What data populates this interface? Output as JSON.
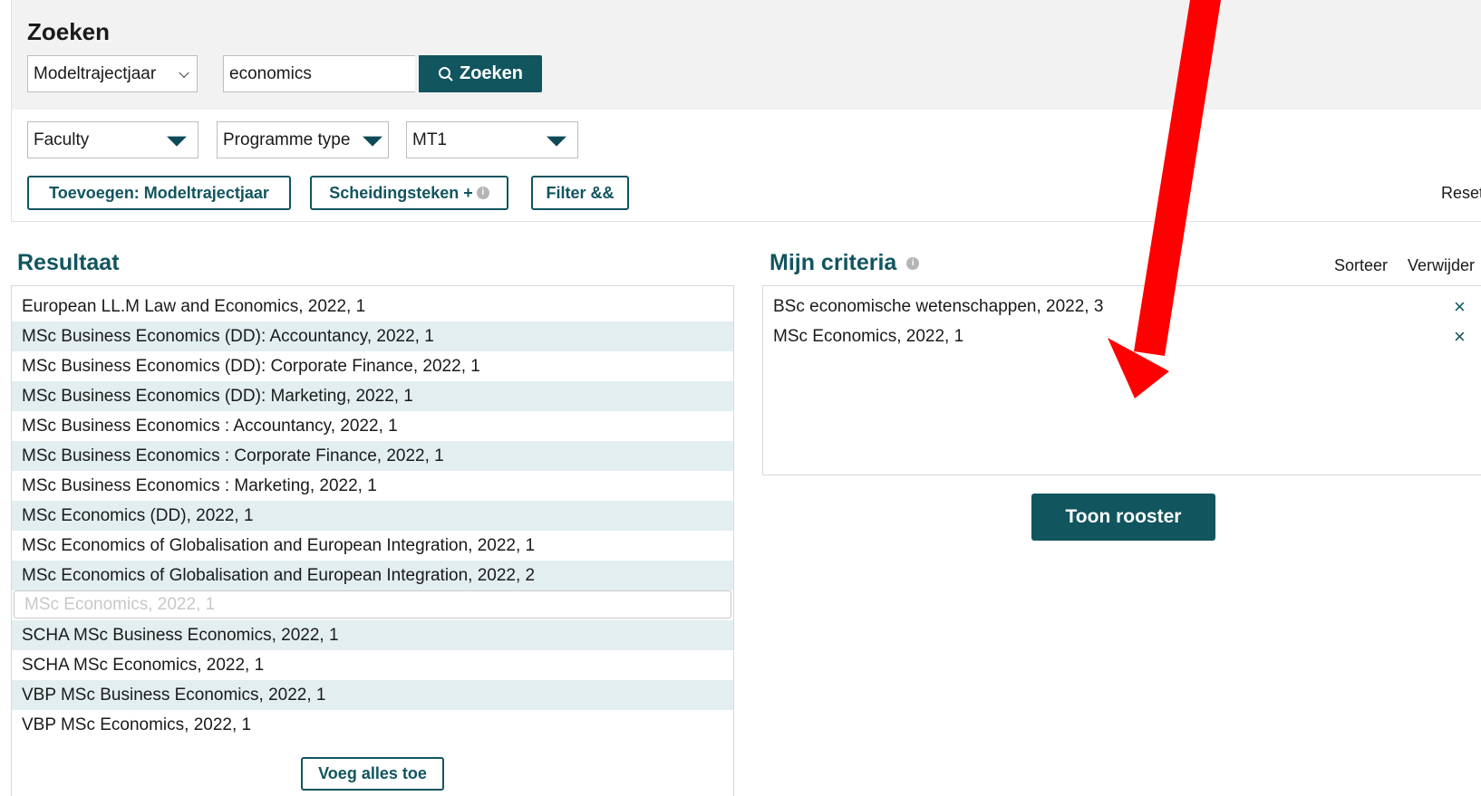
{
  "search": {
    "title": "Zoeken",
    "type_select": "Modeltrajectjaar",
    "query": "economics",
    "search_button": "Zoeken"
  },
  "filters": {
    "faculty": "Faculty",
    "programme_type": "Programme type",
    "mt": "MT1"
  },
  "actions": {
    "add_button": "Toevoegen: Modeltrajectjaar",
    "separator_button": "Scheidingsteken +",
    "filter_button": "Filter &&",
    "reset": "Reset"
  },
  "results": {
    "title": "Resultaat",
    "items": [
      "European LL.M Law and Economics, 2022, 1",
      "MSc Business Economics (DD): Accountancy, 2022, 1",
      "MSc Business Economics (DD): Corporate Finance, 2022, 1",
      "MSc Business Economics (DD): Marketing, 2022, 1",
      "MSc Business Economics : Accountancy, 2022, 1",
      "MSc Business Economics : Corporate Finance, 2022, 1",
      "MSc Business Economics : Marketing, 2022, 1",
      "MSc Economics (DD), 2022, 1",
      "MSc Economics of Globalisation and European Integration, 2022, 1",
      "MSc Economics of Globalisation and European Integration, 2022, 2",
      "MSc Economics, 2022, 1",
      "SCHA MSc Business Economics, 2022, 1",
      "SCHA MSc Economics, 2022, 1",
      "VBP MSc Business Economics, 2022, 1",
      "VBP MSc Economics, 2022, 1"
    ],
    "add_all_button": "Voeg alles toe"
  },
  "criteria": {
    "title": "Mijn criteria",
    "sort_label": "Sorteer",
    "remove_label": "Verwijder",
    "items": [
      "BSc economische wetenschappen, 2022, 3",
      "MSc Economics, 2022, 1"
    ],
    "remove_glyph": "×",
    "show_button": "Toon rooster"
  },
  "colors": {
    "brand": "#11555f",
    "row_alt": "#e3eef0",
    "annotation_arrow": "#ff0000"
  }
}
